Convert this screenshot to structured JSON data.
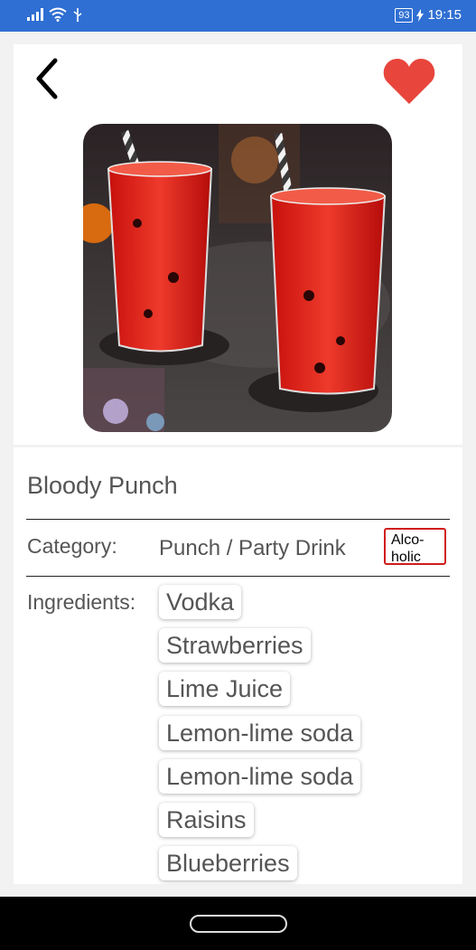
{
  "status_bar": {
    "battery": "93",
    "time": "19:15"
  },
  "drink": {
    "name": "Bloody Punch",
    "category_label": "Category:",
    "category": "Punch / Party Drink",
    "alcoholic_line1": "Alco-",
    "alcoholic_line2": "holic",
    "ingredients_label": "Ingredients:",
    "ingredients": [
      "Vodka",
      "Strawberries",
      "Lime Juice",
      "Lemon-lime soda",
      "Lemon-lime soda",
      "Raisins",
      "Blueberries"
    ]
  },
  "colors": {
    "status_bar": "#2f6fd3",
    "heart": "#e8453c",
    "alcoholic_border": "#d01c1c"
  },
  "icons": {
    "back": "chevron-left-icon",
    "favorite": "heart-icon"
  }
}
